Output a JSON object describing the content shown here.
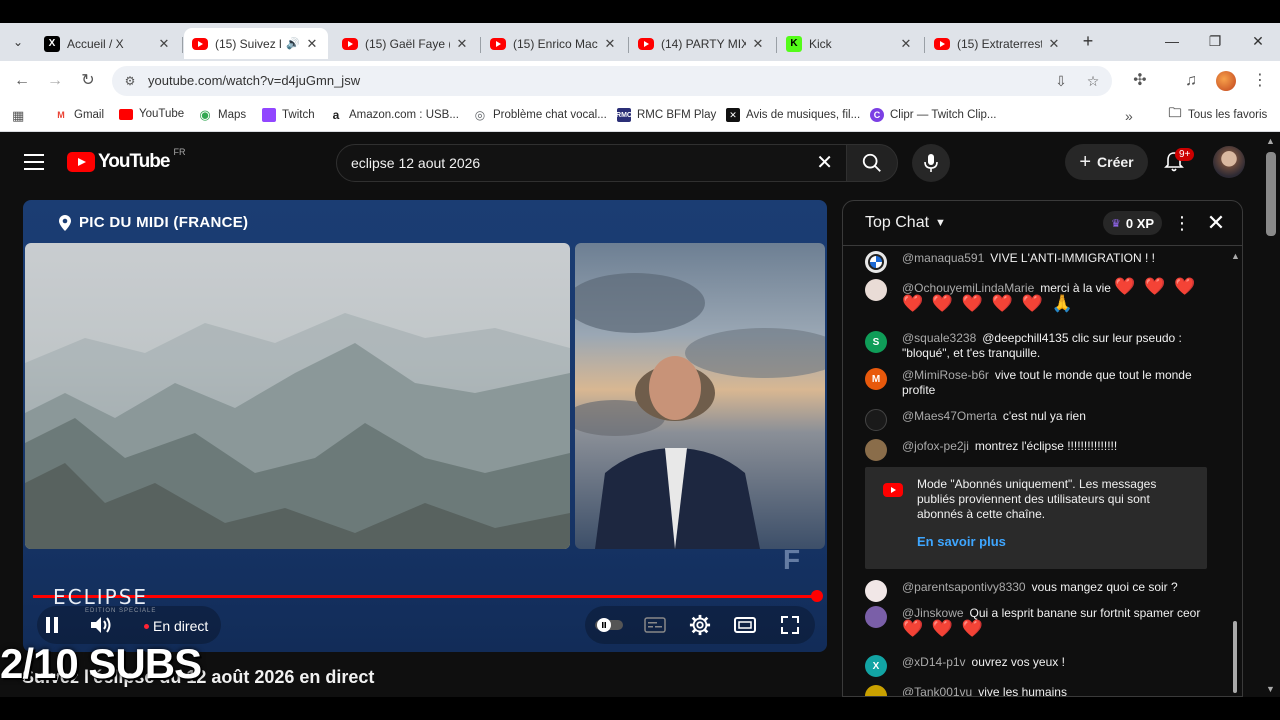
{
  "browser": {
    "tabs": [
      {
        "label": "Accueil / X",
        "icon": "x-logo-icon"
      },
      {
        "label": "(15) Suivez l",
        "icon": "youtube-icon",
        "active": true
      },
      {
        "label": "(15) Gaël Faye (f",
        "icon": "youtube-icon"
      },
      {
        "label": "(15) Enrico Maci",
        "icon": "youtube-icon"
      },
      {
        "label": "(14) PARTY MIX",
        "icon": "youtube-icon"
      },
      {
        "label": "Kick",
        "icon": "kick-icon"
      },
      {
        "label": "(15) Extraterrest",
        "icon": "youtube-icon"
      }
    ],
    "url": "youtube.com/watch?v=d4juGmn_jsw",
    "bookmarks": [
      {
        "label": "Gmail",
        "color": "#ea4335",
        "glyph": "M"
      },
      {
        "label": "YouTube",
        "color": "#ff0000",
        "glyph": "▶"
      },
      {
        "label": "Maps",
        "color": "#34a853",
        "glyph": "●"
      },
      {
        "label": "Twitch",
        "color": "#9146ff",
        "glyph": "T"
      },
      {
        "label": "Amazon.com : USB...",
        "color": "#222222",
        "glyph": "a"
      },
      {
        "label": "Problème chat vocal...",
        "color": "#5f6368",
        "glyph": "◎"
      },
      {
        "label": "RMC BFM Play",
        "color": "#2b2f77",
        "glyph": "R"
      },
      {
        "label": "Avis de musiques, fil...",
        "color": "#111111",
        "glyph": "✕"
      },
      {
        "label": "Clipr — Twitch Clip...",
        "color": "#7b3fe4",
        "glyph": "C"
      }
    ],
    "all_bookmarks_label": "Tous les favoris"
  },
  "youtube": {
    "logo_text": "YouTube",
    "region": "FR",
    "search_query": "eclipse 12 aout 2026",
    "create_label": "Créer",
    "notif_badge": "9+"
  },
  "player": {
    "location_label": "PIC DU MIDI (FRANCE)",
    "logo_text": "ECLIPSE",
    "logo_subtext": "EDITION SPECIALE",
    "live_label": "En direct",
    "progress": 1.0
  },
  "video": {
    "title": "Suivez l'éclipse du 12 août 2026 en direct",
    "overlay_text": "2/10 SUBS"
  },
  "chat": {
    "title": "Top Chat",
    "xp_label": "0 XP",
    "messages": [
      {
        "author": "@manaqua591",
        "text": "VIVE L'ANTI-IMMIGRATION ! !",
        "avatar_color": "#e8e8e8",
        "avatar_text": ""
      },
      {
        "author": "@OchouyemiLindaMarie",
        "text": "merci à la vie",
        "emoji_line1": "❤️ ❤️ ❤️",
        "emoji_line2": "❤️ ❤️ ❤️ ❤️ ❤️ 🙏",
        "avatar_color": "#c9a38f",
        "avatar_text": ""
      },
      {
        "author": "@squale3238",
        "text": "@deepchill4135 clic sur leur pseudo : \"bloqué\", et t'es tranquille.",
        "avatar_color": "#0f9d58",
        "avatar_text": "S"
      },
      {
        "author": "@MimiRose-b6r",
        "text": "vive tout le monde que tout le monde profite",
        "avatar_color": "#e8590c",
        "avatar_text": "M"
      },
      {
        "author": "@Maes47Omerta",
        "text": "c'est nul ya rien",
        "avatar_color": "#1a1a1a",
        "avatar_text": ""
      },
      {
        "author": "@jofox-pe2ji",
        "text": "montrez l'éclipse !!!!!!!!!!!!!!!",
        "avatar_color": "#8a6d4a",
        "avatar_text": ""
      },
      {
        "author": "@parentsapontivy8330",
        "text": "vous mangez quoi ce soir ?",
        "avatar_color": "#f1e7e7",
        "avatar_text": ""
      },
      {
        "author": "@Jinskowe",
        "text": "Qui a lesprit banane sur fortnit spamer ceor",
        "emoji_line1": "❤️ ❤️ ❤️",
        "avatar_color": "#7a5fa8",
        "avatar_text": ""
      },
      {
        "author": "@xD14-p1v",
        "text": "ouvrez vos yeux !",
        "avatar_color": "#12a4a4",
        "avatar_text": "X"
      },
      {
        "author": "@Tank001vu",
        "text": "vive les humains",
        "avatar_color": "#c9a100",
        "avatar_text": ""
      }
    ],
    "system_message": {
      "text": "Mode \"Abonnés uniquement\". Les messages publiés proviennent des utilisateurs qui sont abonnés à cette chaîne.",
      "link_label": "En savoir plus"
    }
  }
}
